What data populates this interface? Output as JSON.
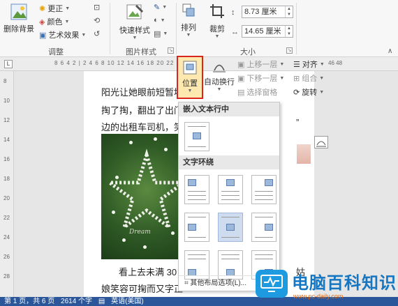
{
  "ribbon": {
    "groups": {
      "adjust": "调整",
      "picture_styles": "图片样式",
      "size": "大小"
    },
    "adjust": {
      "remove_bg": "删除背景",
      "correct": "更正",
      "color": "颜色",
      "artistic": "艺术效果"
    },
    "styles": {
      "quick_styles": "快速样式"
    },
    "arrange": {
      "label": "排列",
      "position": "位置",
      "wrap_text": "自动换行",
      "bring_forward": "上移一层",
      "send_backward": "下移一层",
      "selection_pane": "选择窗格",
      "align": "对齐",
      "group": "组合",
      "rotate": "旋转"
    },
    "crop": "裁剪",
    "size": {
      "height": "8.73 厘米",
      "width": "14.65 厘米"
    }
  },
  "ruler": {
    "numbers": "8 6 4 2 | 2 4 6 8 10 12 14 16 18 20 22 24 26 28",
    "numbers_right": "46 48"
  },
  "vruler": [
    "8",
    "10",
    "12",
    "14",
    "16",
    "18",
    "20",
    "22",
    "24",
    "26",
    "28"
  ],
  "document": {
    "lines": [
      "阳光让她眼前短暂地",
      "掏了掏，翻出了出门",
      "边的出租车司机，笑"
    ],
    "bottom_line": "看上去未满 30",
    "bottom_line2": "娘笑容可掬而又字正",
    "right_fragments": [
      "姑",
      "”"
    ]
  },
  "dropdown": {
    "inline_header": "嵌入文本行中",
    "wrap_header": "文字环绕",
    "more": "其他布局选项(L)..."
  },
  "statusbar": {
    "page": "第 1 页，共 6 页",
    "words": "2614 个字",
    "lang": "英语(美国)"
  },
  "watermark": {
    "title": "电脑百科知识",
    "url": "www.pc-daily.com"
  }
}
